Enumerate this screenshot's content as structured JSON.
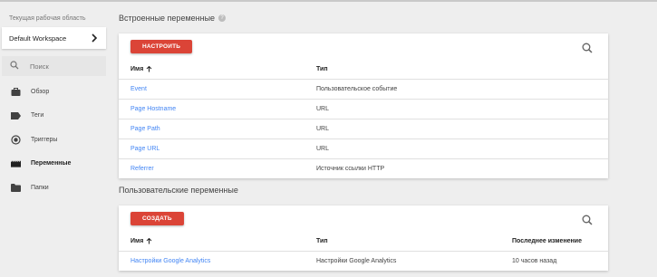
{
  "sidebar": {
    "workspace_caption": "Текущая рабочая область",
    "workspace_name": "Default Workspace",
    "search_placeholder": "Поиск",
    "items": [
      {
        "label": "Обзор",
        "icon": "briefcase-icon"
      },
      {
        "label": "Теги",
        "icon": "tag-icon"
      },
      {
        "label": "Триггеры",
        "icon": "trigger-icon"
      },
      {
        "label": "Переменные",
        "icon": "variables-icon",
        "active": true
      },
      {
        "label": "Папки",
        "icon": "folder-icon"
      }
    ]
  },
  "builtin": {
    "title": "Встроенные переменные",
    "help_icon": "?",
    "button_label": "НАСТРОИТЬ",
    "columns": {
      "name": "Имя",
      "type": "Тип"
    },
    "rows": [
      {
        "name": "Event",
        "type": "Пользовательское событие"
      },
      {
        "name": "Page Hostname",
        "type": "URL"
      },
      {
        "name": "Page Path",
        "type": "URL"
      },
      {
        "name": "Page URL",
        "type": "URL"
      },
      {
        "name": "Referrer",
        "type": "Источник ссылки HTTP"
      }
    ]
  },
  "custom": {
    "title": "Пользовательские переменные",
    "button_label": "СОЗДАТЬ",
    "columns": {
      "name": "Имя",
      "type": "Тип",
      "modified": "Последнее изменение"
    },
    "rows": [
      {
        "name": "Настройки Google Analytics",
        "type": "Настройки Google Analytics",
        "modified": "10 часов назад"
      }
    ]
  },
  "colors": {
    "accent_red": "#db4437",
    "link_blue": "#4285f4",
    "background": "#eeeeee"
  }
}
